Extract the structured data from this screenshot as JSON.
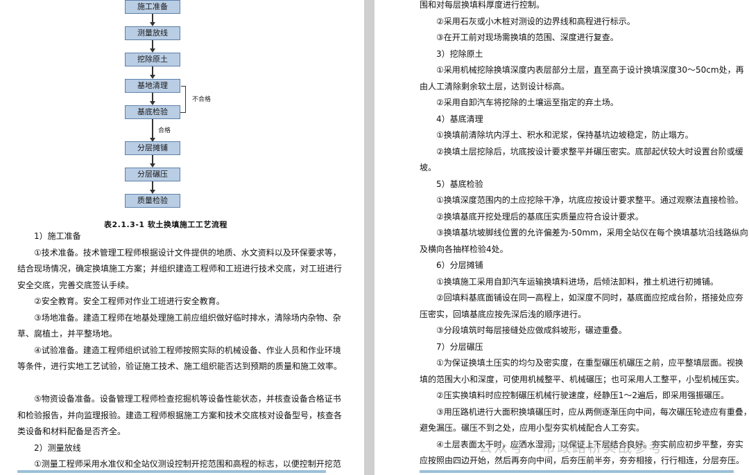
{
  "flowchart": {
    "steps": [
      "施工准备",
      "测量放线",
      "挖除原土",
      "基地清理",
      "基底检验",
      "分层摊铺",
      "分层碾压",
      "质量检验"
    ],
    "fail_label": "不合格",
    "pass_label": "合格",
    "caption": "表2.1.3-1 软土换填施工工艺流程"
  },
  "left_lines": [
    "1）施工准备",
    "①技术准备。技术管理工程师根据设计文件提供的地质、水文资料以及环保要求等，",
    "结合现场情况，确定换填施工方案；并组织建造工程师和工班进行技术交底，对工班进行",
    "安全交底，完善交底签认手续。",
    "②安全教育。安全工程师对作业工班进行安全教育。",
    "③场地准备。建造工程师在地基处理施工前应组织做好临时排水，清除场内杂物、杂",
    "草、腐植土，并平整场地。",
    "④试验准备。建造工程师组织试验工程师按照实际的机械设备、作业人员和作业环境",
    "等条件，进行实地工艺试验，验证施工技术、施工组织能否达到预期的质量和施工效率。",
    "",
    "⑤物资设备准备。设备管理工程师检查挖掘机等设备性能状态，并核查设备合格证书",
    "和检验报告，并向监理报验。建造工程师根据施工方案和技术交底核对设备型号，核查各",
    "类设备和材料配备是否齐全。",
    "2）测量放线",
    "①测量工程师采用水准仪和全站仪测设控制开挖范围和高程的标志，以便控制开挖范"
  ],
  "right_lines": [
    "围和对每层换填料厚度进行控制。",
    "②采用石灰或小木桩对测设的边界线和高程进行标示。",
    "③在开工前对现场需换填的范围、深度进行复查。",
    "3）挖除原土",
    "①采用机械挖除换填深度内表层部分土层，直至高于设计换填深度30～50cm处，再",
    "由人工清除剩余软土层，达到设计标高。",
    "②采用自卸汽车将挖除的土壤运至指定的弃土场。",
    "4）基底清理",
    "①换填前清除坑内浮土、积水和泥浆，保持基坑边坡稳定，防止塌方。",
    "②换填土层挖除后，坑底按设计要求整平并碾压密实。底部起伏较大时设置台阶或缓",
    "坡。",
    "5）基底检验",
    "①换填深度范围内的土应挖除干净，坑底应按设计要求整平。通过观察法直接检验。",
    "②换填基底开挖处理后的基底压实质量应符合设计要求。",
    "③换填基坑坡脚线位置的允许偏差为-50mm，采用全站仪在每个换填基坑沿线路纵向",
    "及横向各抽样检验4处。",
    "6）分层摊铺",
    "①换填施工采用自卸汽车运输换填料进场，后倾法卸料，推土机进行初摊铺。",
    "②回填料基底面铺设在同一高程上，如深度不同时，基底面应挖成台阶，搭接处应夯",
    "压密实，回填基底应按先深后浅的顺序进行。",
    "③分段填筑时每层接缝处应做成斜坡形，碾迹重叠。",
    "7）分层碾压",
    "①为保证换填土压实的均匀及密实度，在重型碾压机碾压之前，应平整填层面。视换",
    "填的范围大小和深度，可使用机械整平、机械碾压；也可采用人工整平，小型机械压实。",
    "②压实换填料时应控制碾压机械行驶速度，经静压1～2遍后，即采用强振碾压。",
    "③用压路机进行大面积换填碾压时，应从两侧逐渐压向中间，每次碾压轮迹应有重叠，",
    "避免漏压。碾压不到之处，应用小型夯实机械配合人工夯实。",
    "④土层表面太干时，应洒水湿润，以保证上下层结合良好。夯实前应初步平整，夯实",
    "应按照由四边开始，然后再夯向中间，后夯压前半夯，夯夯相接，行行相连，分层夯压。"
  ],
  "watermark": "公众号 · 市政路桥实战参考"
}
